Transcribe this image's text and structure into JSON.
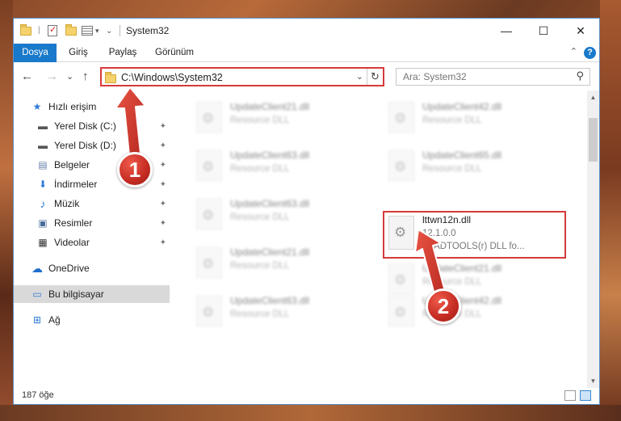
{
  "window": {
    "title": "System32",
    "minimize_glyph": "—",
    "maximize_glyph": "☐",
    "close_glyph": "✕"
  },
  "ribbon": {
    "tabs": [
      {
        "label": "Dosya",
        "active": true
      },
      {
        "label": "Giriş"
      },
      {
        "label": "Paylaş"
      },
      {
        "label": "Görünüm"
      }
    ],
    "help_glyph": "?",
    "collapse_glyph": "⌃"
  },
  "nav": {
    "back_glyph": "←",
    "forward_glyph": "→",
    "recent_glyph": "⌄",
    "up_glyph": "↑"
  },
  "address": {
    "path": "C:\\Windows\\System32",
    "dropdown_glyph": "⌄",
    "refresh_glyph": "↻"
  },
  "search": {
    "placeholder": "Ara: System32",
    "icon_glyph": "⚲"
  },
  "sidebar": {
    "items": [
      {
        "label": "Hızlı erişim",
        "icon": "star-icon",
        "glyph": "★",
        "color": "#2e7bd6"
      },
      {
        "label": "Yerel Disk (C:)",
        "icon": "drive-icon",
        "glyph": "▬",
        "pinned": true
      },
      {
        "label": "Yerel Disk (D:)",
        "icon": "drive-icon",
        "glyph": "▬",
        "pinned": true
      },
      {
        "label": "Belgeler",
        "icon": "documents-icon",
        "glyph": "▤",
        "pinned": true
      },
      {
        "label": "İndirmeler",
        "icon": "download-icon",
        "glyph": "⬇",
        "pinned": true
      },
      {
        "label": "Müzik",
        "icon": "music-icon",
        "glyph": "♪",
        "pinned": true
      },
      {
        "label": "Resimler",
        "icon": "pictures-icon",
        "glyph": "▣",
        "pinned": true
      },
      {
        "label": "Videolar",
        "icon": "video-icon",
        "glyph": "▦",
        "pinned": true
      },
      {
        "label": "OneDrive",
        "icon": "cloud-icon",
        "glyph": "☁"
      },
      {
        "label": "Bu bilgisayar",
        "icon": "computer-icon",
        "glyph": "▭",
        "selected": true
      },
      {
        "label": "Ağ",
        "icon": "network-icon",
        "glyph": "⊞"
      }
    ],
    "pin_glyph": "✦"
  },
  "files": {
    "left_column": [
      {
        "name": "UpdateClient21.dll",
        "type": "Resource DLL"
      },
      {
        "name": "UpdateClient63.dll",
        "type": "Resource DLL"
      },
      {
        "name": "UpdateClient63.dll",
        "type": "Resource DLL"
      },
      {
        "name": "UpdateClient21.dll",
        "type": "Resource DLL"
      },
      {
        "name": "UpdateClient63.dll",
        "type": "Resource DLL"
      }
    ],
    "right_column": [
      {
        "name": "UpdateClient42.dll",
        "type": "Resource DLL"
      },
      {
        "name": "UpdateClient65.dll",
        "type": "Resource DLL"
      },
      {
        "name": "UpdateClient21.dll",
        "type": "Resource DLL"
      },
      {
        "name": "UpdateClient42.dll",
        "type": "Resource DLL"
      }
    ],
    "highlighted": {
      "name": "lttwn12n.dll",
      "version": "12.1.0.0",
      "description": "LEADTOOLS(r) DLL fo..."
    }
  },
  "scrollbar": {
    "up_glyph": "▲",
    "down_glyph": "▼"
  },
  "status": {
    "item_count": "187 öğe"
  },
  "annotations": {
    "step1": "1",
    "step2": "2",
    "color": "#d63a3a"
  }
}
